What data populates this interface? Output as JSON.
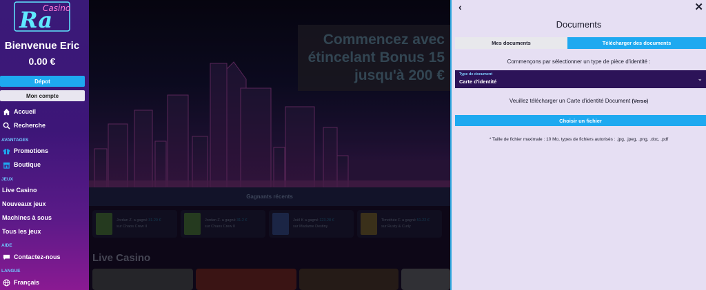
{
  "sidebar": {
    "logo": "Casino Ra",
    "welcome": "Bienvenue Eric",
    "balance": "0.00 €",
    "deposit_button": "Dépot",
    "account_button": "Mon compte",
    "items": [
      {
        "label": "Accueil",
        "icon": "home-icon"
      },
      {
        "label": "Recherche",
        "icon": "search-icon"
      }
    ],
    "sections": {
      "advantages": "AVANTAGES",
      "games": "JEUX",
      "help": "AIDE",
      "language": "LANGUE"
    },
    "advantages_items": [
      {
        "label": "Promotions",
        "icon": "gift-icon"
      },
      {
        "label": "Boutique",
        "icon": "shop-icon"
      }
    ],
    "games_items": [
      "Live Casino",
      "Nouveaux jeux",
      "Machines à sous",
      "Tous les jeux"
    ],
    "help_items": [
      {
        "label": "Contactez-nous",
        "icon": "chat-icon"
      }
    ],
    "language_items": [
      {
        "label": "Français",
        "icon": "globe-icon"
      }
    ]
  },
  "main": {
    "promo": [
      "Commencez avec",
      "étincelant Bonus 15",
      "jusqu'à 200 €"
    ],
    "winners_title": "Gagnants récents",
    "winners": [
      {
        "name": "Jordan Z. a gagné",
        "amount": "31.20 €",
        "game": "sur Chaos Crew II"
      },
      {
        "name": "Jordan Z. a gagné",
        "amount": "31.2 €",
        "game": "sur Chaos Crew II"
      },
      {
        "name": "Joël K a gagné",
        "amount": "123.28 €",
        "game": "sur Madame Destiny"
      },
      {
        "name": "Timothée F. a gagné",
        "amount": "51.22 €",
        "game": "sur Rusty & Curly"
      }
    ],
    "live_casino_title": "Live Casino"
  },
  "panel": {
    "title": "Documents",
    "tab_mine": "Mes documents",
    "tab_upload": "Télécharger des documents",
    "intro": "Commençons par sélectionner un type de pièce d'identité :",
    "select_label": "Type de document",
    "select_value": "Carte d'identité",
    "upload_msg": "Veuillez télécharger un Carte d'identité Document",
    "upload_side": "(Verso)",
    "choose_button": "Choisir un fichier",
    "file_note": "* Taille de fichier maximale : 10 Mo, types de fichiers autorisés : .jpg, .jpeg, .png, .doc, .pdf"
  },
  "colors": {
    "accent": "#1ea9f0",
    "sidebar_top": "#3a1a78",
    "panel_bg": "#e6dff3",
    "select_bg": "#2c1358"
  }
}
